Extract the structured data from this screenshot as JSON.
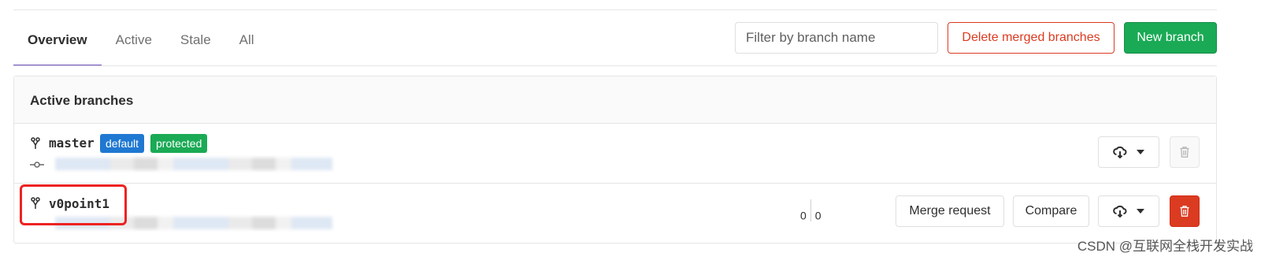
{
  "tabs": [
    {
      "label": "Overview",
      "active": true
    },
    {
      "label": "Active",
      "active": false
    },
    {
      "label": "Stale",
      "active": false
    },
    {
      "label": "All",
      "active": false
    }
  ],
  "filter": {
    "placeholder": "Filter by branch name"
  },
  "buttons": {
    "delete_merged": "Delete merged branches",
    "new_branch": "New branch",
    "merge_request": "Merge request",
    "compare": "Compare"
  },
  "panel": {
    "title": "Active branches"
  },
  "branches": [
    {
      "name": "master",
      "badges": [
        "default",
        "protected"
      ]
    },
    {
      "name": "v0point1",
      "behind": "0",
      "ahead": "0"
    }
  ],
  "icons": {
    "branch": "branch-icon",
    "commit": "commit-icon",
    "download": "cloud-download-icon",
    "caret": "caret-down-icon",
    "trash": "trash-icon"
  },
  "colors": {
    "accent": "#6b4fbb",
    "danger": "#db3b21",
    "success": "#1aaa55",
    "info": "#1f78d1"
  },
  "watermark": "CSDN @互联网全栈开发实战"
}
